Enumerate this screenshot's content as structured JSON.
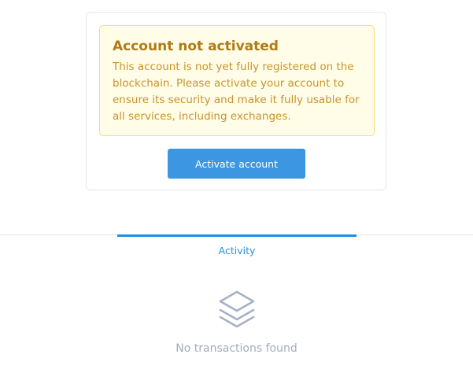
{
  "notice": {
    "title": "Account not activated",
    "message": "This account is not yet fully registered on the blockchain. Please activate your account to ensure its security and make it fully usable for all services, including exchanges."
  },
  "actions": {
    "activate_label": "Activate account"
  },
  "tabs": [
    {
      "label": "Activity",
      "active": true
    }
  ],
  "activity": {
    "empty_icon": "layers-icon",
    "empty_message": "No transactions found"
  },
  "colors": {
    "accent": "#1d8fe1",
    "button": "#3c96e2",
    "warning_bg": "#fffde8",
    "warning_border": "#f3dd7d",
    "warning_title": "#b07a16",
    "warning_text": "#c8932c",
    "muted": "#a5adb8"
  }
}
